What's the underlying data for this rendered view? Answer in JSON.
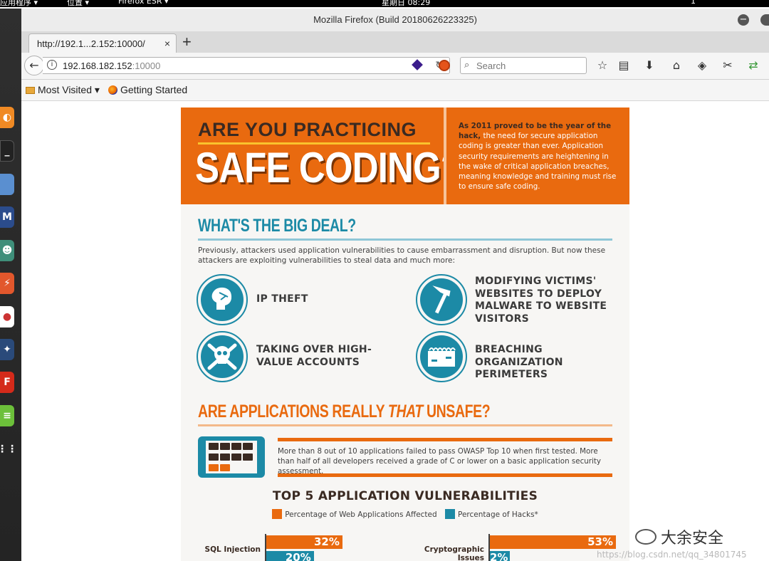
{
  "desktop": {
    "menu_apps": "应用程序 ▾",
    "menu_places": "位置 ▾",
    "menu_firefox": "Firefox ESR ▾",
    "clock": "星期日 08:29",
    "workspace": "1"
  },
  "window": {
    "title": "Mozilla Firefox (Build 20180626223325)"
  },
  "tab": {
    "label": "http://192.1...2.152:10000/",
    "close": "×"
  },
  "newtab": "+",
  "urlbar": {
    "host": "192.168.182.152",
    "port": ":10000",
    "reload": "↻"
  },
  "search": {
    "placeholder": "Search"
  },
  "bookmarks": {
    "most_visited": "Most Visited",
    "getting_started": "Getting Started"
  },
  "page": {
    "hero": {
      "line1": "ARE YOU PRACTICING",
      "line2": "SAFE CODING?",
      "intro_bold": "As 2011 proved to be the year of the hack,",
      "intro": "the need for secure application coding is greater than ever. Application security requirements are heightening in the wake of critical application breaches, meaning knowledge and training must rise to ensure safe coding."
    },
    "section1": {
      "heading": "WHAT'S THE BIG DEAL?",
      "text": "Previously, attackers used application vulnerabilities to cause embarrassment and disruption. But now these attackers are exploiting vulnerabilities to steal data and much more:",
      "threats": [
        {
          "label": "IP THEFT"
        },
        {
          "label": "MODIFYING VICTIMS' WEBSITES TO DEPLOY MALWARE TO WEBSITE VISITORS"
        },
        {
          "label": "TAKING OVER HIGH-VALUE ACCOUNTS"
        },
        {
          "label": "BREACHING ORGANIZATION PERIMETERS"
        }
      ]
    },
    "section2": {
      "heading_pre": "ARE APPLICATIONS REALLY ",
      "heading_em": "THAT",
      "heading_post": " UNSAFE?",
      "stat": "More than 8 out of 10 applications failed to pass OWASP Top 10 when first tested. More than half of all developers received a grade of C or lower on a basic application security assessment."
    },
    "chart": {
      "title": "TOP 5 APPLICATION VULNERABILITIES",
      "legend_web": "Percentage of Web Applications Affected",
      "legend_hacks": "Percentage of Hacks*",
      "color_web": "#e96a0f",
      "color_hacks": "#1c8aa6"
    }
  },
  "chart_data": {
    "type": "bar",
    "title": "TOP 5 APPLICATION VULNERABILITIES",
    "categories": [
      "SQL Injection",
      "Cryptographic Issues"
    ],
    "series": [
      {
        "name": "Percentage of Web Applications Affected",
        "values": [
          32,
          53
        ],
        "labels": [
          "32%",
          "53%"
        ]
      },
      {
        "name": "Percentage of Hacks*",
        "values": [
          20,
          2
        ],
        "labels": [
          "20%",
          "2%"
        ]
      }
    ]
  },
  "watermark": {
    "brand": "大余安全",
    "url": "https://blog.csdn.net/qq_34801745"
  }
}
